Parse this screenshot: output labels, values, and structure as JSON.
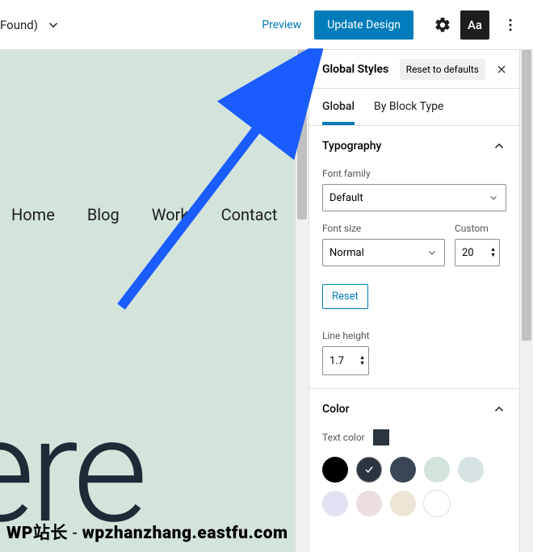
{
  "topbar": {
    "found_label": "Found)",
    "preview": "Preview",
    "update": "Update Design",
    "aa": "Aa"
  },
  "canvas": {
    "nav": [
      "Home",
      "Blog",
      "Work",
      "Contact"
    ],
    "hero": "ere"
  },
  "sidebar": {
    "title": "Global Styles",
    "reset_defaults": "Reset to defaults",
    "tabs": {
      "global": "Global",
      "byblock": "By Block Type"
    },
    "typography": {
      "title": "Typography",
      "font_family_label": "Font family",
      "font_family_value": "Default",
      "font_size_label": "Font size",
      "font_size_value": "Normal",
      "custom_label": "Custom",
      "custom_value": "20",
      "reset": "Reset",
      "line_height_label": "Line height",
      "line_height_value": "1.7"
    },
    "color": {
      "title": "Color",
      "text_color_label": "Text color",
      "text_color_value": "#2b3440",
      "palette": [
        {
          "hex": "#000000",
          "selected": false
        },
        {
          "hex": "#2b3440",
          "selected": true
        },
        {
          "hex": "#3a4556",
          "selected": false
        },
        {
          "hex": "#d3e4db",
          "selected": false
        },
        {
          "hex": "#d7e2e2",
          "selected": false
        },
        {
          "hex": "#dfe2f2",
          "selected": false
        },
        {
          "hex": "#ecdedd",
          "selected": false
        },
        {
          "hex": "#ece4d4",
          "selected": false
        },
        {
          "hex": "#ffffff",
          "selected": false
        }
      ]
    }
  },
  "watermark": {
    "a": "WP站长",
    "b": " - ",
    "c": "wpzhanzhang.eastfu.com"
  }
}
